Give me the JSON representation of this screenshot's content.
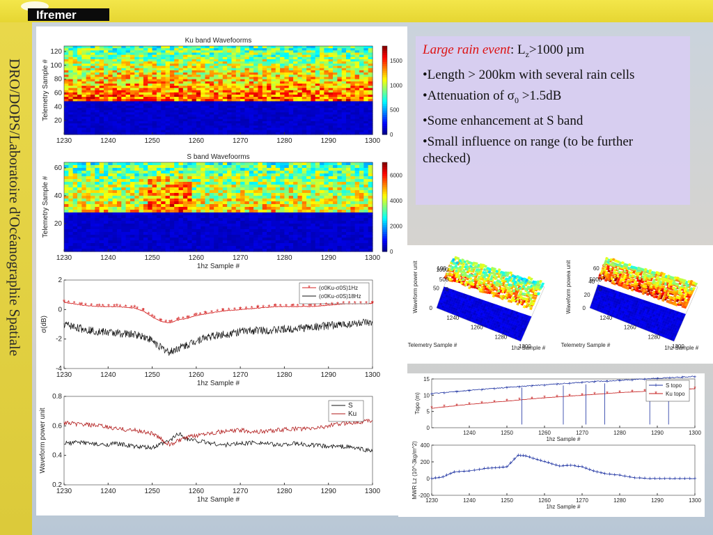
{
  "header": {
    "logo_text": "Ifremer"
  },
  "sidebar": {
    "vertical_title": "DRO/DOPS/Laboratoire d'Océanographie Spatiale"
  },
  "text_panel": {
    "heading_italic": "Large rain event",
    "heading_rest_prefix": ": L",
    "heading_sub": "z",
    "heading_rest_suffix": ">1000 µm",
    "bullets": [
      {
        "id": "b1",
        "text": "•Length > 200km with several rain cells"
      },
      {
        "id": "b2",
        "prefix": "•Attenuation of σ",
        "sub": "0",
        "suffix": " >1.5dB"
      },
      {
        "id": "b3",
        "text": "•Some enhancement at S band"
      },
      {
        "id": "b4",
        "text": "•Small influence on range (to be further checked)"
      }
    ]
  },
  "chart_data": [
    {
      "type": "heatmap",
      "title": "Ku band Wavefoorms",
      "xlabel": "",
      "ylabel": "Telemetry Sample #",
      "xlim": [
        1230,
        1300
      ],
      "xticks": [
        1230,
        1240,
        1250,
        1260,
        1270,
        1280,
        1290,
        1300
      ],
      "yticks": [
        20,
        40,
        60,
        80,
        100,
        120
      ],
      "colorbar_ticks": [
        0,
        500,
        1000,
        1500
      ]
    },
    {
      "type": "heatmap",
      "title": "S band Wavefoorms",
      "xlabel": "1hz Sample #",
      "ylabel": "Telemetry Sample #",
      "xlim": [
        1230,
        1300
      ],
      "xticks": [
        1230,
        1240,
        1250,
        1260,
        1270,
        1280,
        1290,
        1300
      ],
      "yticks": [
        20,
        40,
        60
      ],
      "colorbar_ticks": [
        0,
        2000,
        4000,
        6000
      ]
    },
    {
      "type": "line",
      "xlabel": "1hz Sample #",
      "ylabel": "σ(dB)",
      "xlim": [
        1230,
        1300
      ],
      "ylim": [
        -4,
        2
      ],
      "xticks": [
        1230,
        1240,
        1250,
        1260,
        1270,
        1280,
        1290,
        1300
      ],
      "yticks": [
        -4,
        -2,
        0,
        2
      ],
      "legend": [
        "(σ0Ku-σ0S)1Hz",
        "(σ0Ku-σ0S)18Hz"
      ],
      "x": [
        1230,
        1234,
        1238,
        1242,
        1246,
        1248,
        1250,
        1252,
        1254,
        1256,
        1258,
        1260,
        1262,
        1266,
        1270,
        1274,
        1278,
        1282,
        1286,
        1290,
        1294,
        1298,
        1300
      ],
      "series": [
        {
          "name": "(σ0Ku-σ0S)1Hz",
          "values": [
            0.5,
            0.3,
            0.2,
            0.2,
            0.1,
            -0.1,
            -0.5,
            -0.8,
            -0.9,
            -0.7,
            -0.6,
            -0.4,
            -0.3,
            -0.1,
            0.0,
            0.1,
            0.2,
            0.2,
            0.2,
            0.3,
            0.4,
            0.4,
            0.4
          ]
        },
        {
          "name": "(σ0Ku-σ0S)18Hz",
          "values": [
            -1.0,
            -1.3,
            -1.5,
            -1.6,
            -1.7,
            -1.8,
            -2.1,
            -2.6,
            -2.9,
            -2.6,
            -2.4,
            -2.1,
            -1.9,
            -1.7,
            -1.5,
            -1.4,
            -1.4,
            -1.3,
            -1.2,
            -1.1,
            -1.0,
            -0.9,
            -1.0
          ]
        }
      ]
    },
    {
      "type": "line",
      "xlabel": "1hz Sample #",
      "ylabel": "Waveform power unit",
      "xlim": [
        1230,
        1300
      ],
      "ylim": [
        0.2,
        0.8
      ],
      "xticks": [
        1230,
        1240,
        1250,
        1260,
        1270,
        1280,
        1290,
        1300
      ],
      "yticks": [
        0.2,
        0.4,
        0.6,
        0.8
      ],
      "legend": [
        "S",
        "Ku"
      ],
      "x": [
        1230,
        1234,
        1238,
        1242,
        1246,
        1250,
        1254,
        1256,
        1258,
        1262,
        1266,
        1270,
        1274,
        1278,
        1282,
        1286,
        1290,
        1294,
        1298,
        1300
      ],
      "series": [
        {
          "name": "S",
          "values": [
            0.48,
            0.49,
            0.47,
            0.48,
            0.46,
            0.45,
            0.5,
            0.55,
            0.51,
            0.49,
            0.47,
            0.48,
            0.49,
            0.47,
            0.48,
            0.47,
            0.46,
            0.46,
            0.44,
            0.43
          ]
        },
        {
          "name": "Ku",
          "values": [
            0.62,
            0.61,
            0.6,
            0.58,
            0.57,
            0.55,
            0.47,
            0.5,
            0.52,
            0.55,
            0.56,
            0.57,
            0.56,
            0.57,
            0.58,
            0.58,
            0.6,
            0.62,
            0.63,
            0.64
          ]
        }
      ]
    },
    {
      "type": "surface",
      "xlabel": "1hz Sample #",
      "ylabel": "Telemetry Sample #",
      "zlabel": "Waveform power unit",
      "xticks": [
        1240,
        1260,
        1280,
        1300
      ],
      "yticks": [
        0,
        50,
        100
      ],
      "zticks": [
        0,
        500,
        1000
      ]
    },
    {
      "type": "surface",
      "xlabel": "1hz Sample #",
      "ylabel": "Telemetry Sample #",
      "zlabel": "Waveform powea unit",
      "xticks": [
        1240,
        1260,
        1280,
        1300
      ],
      "yticks": [
        0,
        20,
        40,
        60
      ],
      "zticks": [
        0,
        5000
      ]
    },
    {
      "type": "line",
      "xlabel": "1hz Sample #",
      "ylabel": "Topo (m)",
      "xlim": [
        1230,
        1300
      ],
      "ylim": [
        0,
        15
      ],
      "xticks": [
        1240,
        1250,
        1260,
        1270,
        1280,
        1290,
        1300
      ],
      "yticks": [
        0,
        5,
        10,
        15
      ],
      "legend": [
        "S topo",
        "Ku topo"
      ],
      "x": [
        1230,
        1240,
        1250,
        1260,
        1270,
        1280,
        1290,
        1300
      ],
      "series": [
        {
          "name": "S topo",
          "values": [
            10.5,
            11.5,
            12.4,
            13.2,
            14.0,
            14.6,
            15.2,
            15.8
          ]
        },
        {
          "name": "Ku topo",
          "values": [
            6.0,
            7.2,
            8.2,
            9.2,
            10.0,
            10.8,
            11.4,
            12.0
          ]
        }
      ],
      "spikes": [
        1254,
        1265,
        1271,
        1276,
        1288,
        1293
      ]
    },
    {
      "type": "line",
      "xlabel": "1hz Sample #",
      "ylabel": "MWR Lz (10^-3kg/m^2)",
      "xlim": [
        1230,
        1300
      ],
      "ylim": [
        -200,
        400
      ],
      "xticks": [
        1230,
        1240,
        1250,
        1260,
        1270,
        1280,
        1290,
        1300
      ],
      "yticks": [
        -200,
        0,
        200,
        400
      ],
      "x": [
        1230,
        1233,
        1236,
        1240,
        1244,
        1247,
        1250,
        1253,
        1255,
        1258,
        1261,
        1264,
        1267,
        1270,
        1273,
        1276,
        1280,
        1284,
        1288,
        1292,
        1296,
        1300
      ],
      "series": [
        {
          "name": "",
          "values": [
            0,
            20,
            80,
            90,
            120,
            130,
            140,
            280,
            270,
            230,
            190,
            150,
            160,
            140,
            90,
            60,
            40,
            10,
            0,
            0,
            0,
            0
          ]
        }
      ]
    }
  ]
}
